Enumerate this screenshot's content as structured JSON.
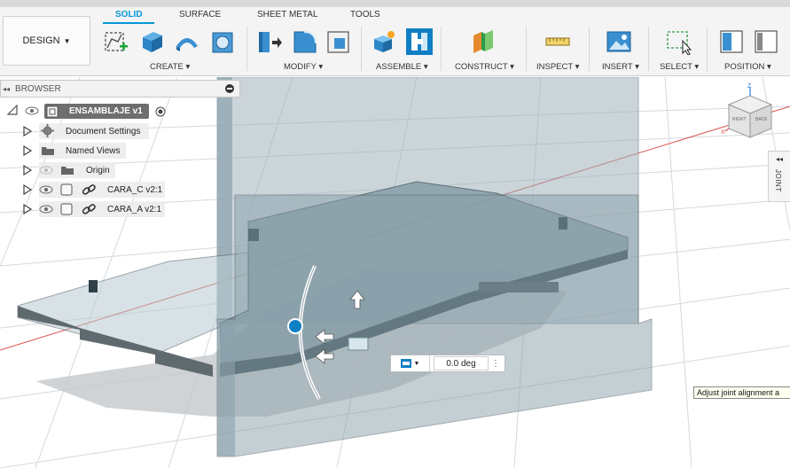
{
  "toolbar": {
    "design_label": "DESIGN",
    "tabs": [
      {
        "label": "SOLID",
        "active": true
      },
      {
        "label": "SURFACE"
      },
      {
        "label": "SHEET METAL"
      },
      {
        "label": "TOOLS"
      }
    ],
    "groups": {
      "create": "CREATE",
      "modify": "MODIFY",
      "assemble": "ASSEMBLE",
      "construct": "CONSTRUCT",
      "inspect": "INSPECT",
      "insert": "INSERT",
      "select": "SELECT",
      "position": "POSITION"
    }
  },
  "browser": {
    "title": "BROWSER",
    "root": "ENSAMBLAJE v1",
    "items": [
      {
        "label": "Document Settings",
        "icon": "gear-icon"
      },
      {
        "label": "Named Views",
        "icon": "folder-icon"
      },
      {
        "label": "Origin",
        "icon": "folder-icon"
      },
      {
        "label": "CARA_C v2:1",
        "icon": "component-icon"
      },
      {
        "label": "CARA_A v2:1",
        "icon": "component-icon"
      }
    ]
  },
  "viewcube": {
    "right": "RIGHT",
    "back": "BACK",
    "axis_z": "Z",
    "axis_x": "X"
  },
  "joint_panel": {
    "label": "JOINT"
  },
  "angle_input": {
    "value": "0.0 deg"
  },
  "tooltip": {
    "text": "Adjust joint alignment a"
  },
  "colors": {
    "accent": "#0696d7",
    "panel_fill": "#8ba2ad",
    "panel_edge": "#3c4e56",
    "grid_line": "#cfd6db",
    "axis_red": "#d9534f"
  }
}
